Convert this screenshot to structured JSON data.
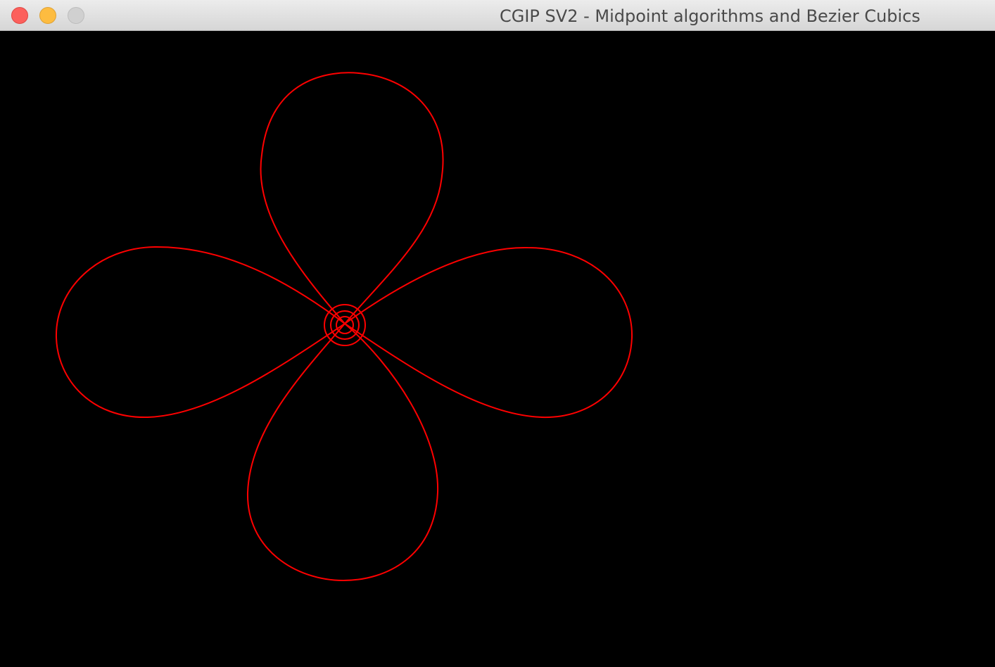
{
  "window": {
    "title": "CGIP SV2 - Midpoint algorithms and Bezier Cubics",
    "controls": {
      "close": "close-button",
      "minimize": "minimize-button",
      "zoom": "zoom-button"
    }
  },
  "colors": {
    "canvas_background": "#000000",
    "stroke": "#ff0000",
    "close": "#fc605c",
    "minimize": "#fdbc40",
    "zoom": "#d0d0d0"
  },
  "drawing": {
    "shapes": [
      "bezier-petal-top",
      "bezier-petal-right",
      "bezier-petal-bottom",
      "bezier-petal-left",
      "midpoint-circle-outer",
      "midpoint-circle-middle",
      "midpoint-circle-inner"
    ]
  }
}
